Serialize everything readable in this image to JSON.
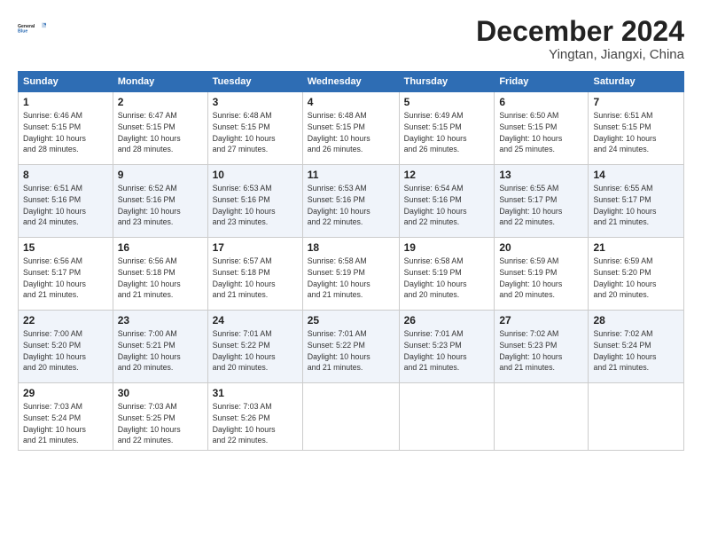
{
  "header": {
    "logo_line1": "General",
    "logo_line2": "Blue",
    "month": "December 2024",
    "location": "Yingtan, Jiangxi, China"
  },
  "days_of_week": [
    "Sunday",
    "Monday",
    "Tuesday",
    "Wednesday",
    "Thursday",
    "Friday",
    "Saturday"
  ],
  "weeks": [
    [
      {
        "day": "1",
        "detail": "Sunrise: 6:46 AM\nSunset: 5:15 PM\nDaylight: 10 hours\nand 28 minutes."
      },
      {
        "day": "2",
        "detail": "Sunrise: 6:47 AM\nSunset: 5:15 PM\nDaylight: 10 hours\nand 28 minutes."
      },
      {
        "day": "3",
        "detail": "Sunrise: 6:48 AM\nSunset: 5:15 PM\nDaylight: 10 hours\nand 27 minutes."
      },
      {
        "day": "4",
        "detail": "Sunrise: 6:48 AM\nSunset: 5:15 PM\nDaylight: 10 hours\nand 26 minutes."
      },
      {
        "day": "5",
        "detail": "Sunrise: 6:49 AM\nSunset: 5:15 PM\nDaylight: 10 hours\nand 26 minutes."
      },
      {
        "day": "6",
        "detail": "Sunrise: 6:50 AM\nSunset: 5:15 PM\nDaylight: 10 hours\nand 25 minutes."
      },
      {
        "day": "7",
        "detail": "Sunrise: 6:51 AM\nSunset: 5:15 PM\nDaylight: 10 hours\nand 24 minutes."
      }
    ],
    [
      {
        "day": "8",
        "detail": "Sunrise: 6:51 AM\nSunset: 5:16 PM\nDaylight: 10 hours\nand 24 minutes."
      },
      {
        "day": "9",
        "detail": "Sunrise: 6:52 AM\nSunset: 5:16 PM\nDaylight: 10 hours\nand 23 minutes."
      },
      {
        "day": "10",
        "detail": "Sunrise: 6:53 AM\nSunset: 5:16 PM\nDaylight: 10 hours\nand 23 minutes."
      },
      {
        "day": "11",
        "detail": "Sunrise: 6:53 AM\nSunset: 5:16 PM\nDaylight: 10 hours\nand 22 minutes."
      },
      {
        "day": "12",
        "detail": "Sunrise: 6:54 AM\nSunset: 5:16 PM\nDaylight: 10 hours\nand 22 minutes."
      },
      {
        "day": "13",
        "detail": "Sunrise: 6:55 AM\nSunset: 5:17 PM\nDaylight: 10 hours\nand 22 minutes."
      },
      {
        "day": "14",
        "detail": "Sunrise: 6:55 AM\nSunset: 5:17 PM\nDaylight: 10 hours\nand 21 minutes."
      }
    ],
    [
      {
        "day": "15",
        "detail": "Sunrise: 6:56 AM\nSunset: 5:17 PM\nDaylight: 10 hours\nand 21 minutes."
      },
      {
        "day": "16",
        "detail": "Sunrise: 6:56 AM\nSunset: 5:18 PM\nDaylight: 10 hours\nand 21 minutes."
      },
      {
        "day": "17",
        "detail": "Sunrise: 6:57 AM\nSunset: 5:18 PM\nDaylight: 10 hours\nand 21 minutes."
      },
      {
        "day": "18",
        "detail": "Sunrise: 6:58 AM\nSunset: 5:19 PM\nDaylight: 10 hours\nand 21 minutes."
      },
      {
        "day": "19",
        "detail": "Sunrise: 6:58 AM\nSunset: 5:19 PM\nDaylight: 10 hours\nand 20 minutes."
      },
      {
        "day": "20",
        "detail": "Sunrise: 6:59 AM\nSunset: 5:19 PM\nDaylight: 10 hours\nand 20 minutes."
      },
      {
        "day": "21",
        "detail": "Sunrise: 6:59 AM\nSunset: 5:20 PM\nDaylight: 10 hours\nand 20 minutes."
      }
    ],
    [
      {
        "day": "22",
        "detail": "Sunrise: 7:00 AM\nSunset: 5:20 PM\nDaylight: 10 hours\nand 20 minutes."
      },
      {
        "day": "23",
        "detail": "Sunrise: 7:00 AM\nSunset: 5:21 PM\nDaylight: 10 hours\nand 20 minutes."
      },
      {
        "day": "24",
        "detail": "Sunrise: 7:01 AM\nSunset: 5:22 PM\nDaylight: 10 hours\nand 20 minutes."
      },
      {
        "day": "25",
        "detail": "Sunrise: 7:01 AM\nSunset: 5:22 PM\nDaylight: 10 hours\nand 21 minutes."
      },
      {
        "day": "26",
        "detail": "Sunrise: 7:01 AM\nSunset: 5:23 PM\nDaylight: 10 hours\nand 21 minutes."
      },
      {
        "day": "27",
        "detail": "Sunrise: 7:02 AM\nSunset: 5:23 PM\nDaylight: 10 hours\nand 21 minutes."
      },
      {
        "day": "28",
        "detail": "Sunrise: 7:02 AM\nSunset: 5:24 PM\nDaylight: 10 hours\nand 21 minutes."
      }
    ],
    [
      {
        "day": "29",
        "detail": "Sunrise: 7:03 AM\nSunset: 5:24 PM\nDaylight: 10 hours\nand 21 minutes."
      },
      {
        "day": "30",
        "detail": "Sunrise: 7:03 AM\nSunset: 5:25 PM\nDaylight: 10 hours\nand 22 minutes."
      },
      {
        "day": "31",
        "detail": "Sunrise: 7:03 AM\nSunset: 5:26 PM\nDaylight: 10 hours\nand 22 minutes."
      },
      {
        "day": "",
        "detail": ""
      },
      {
        "day": "",
        "detail": ""
      },
      {
        "day": "",
        "detail": ""
      },
      {
        "day": "",
        "detail": ""
      }
    ]
  ]
}
